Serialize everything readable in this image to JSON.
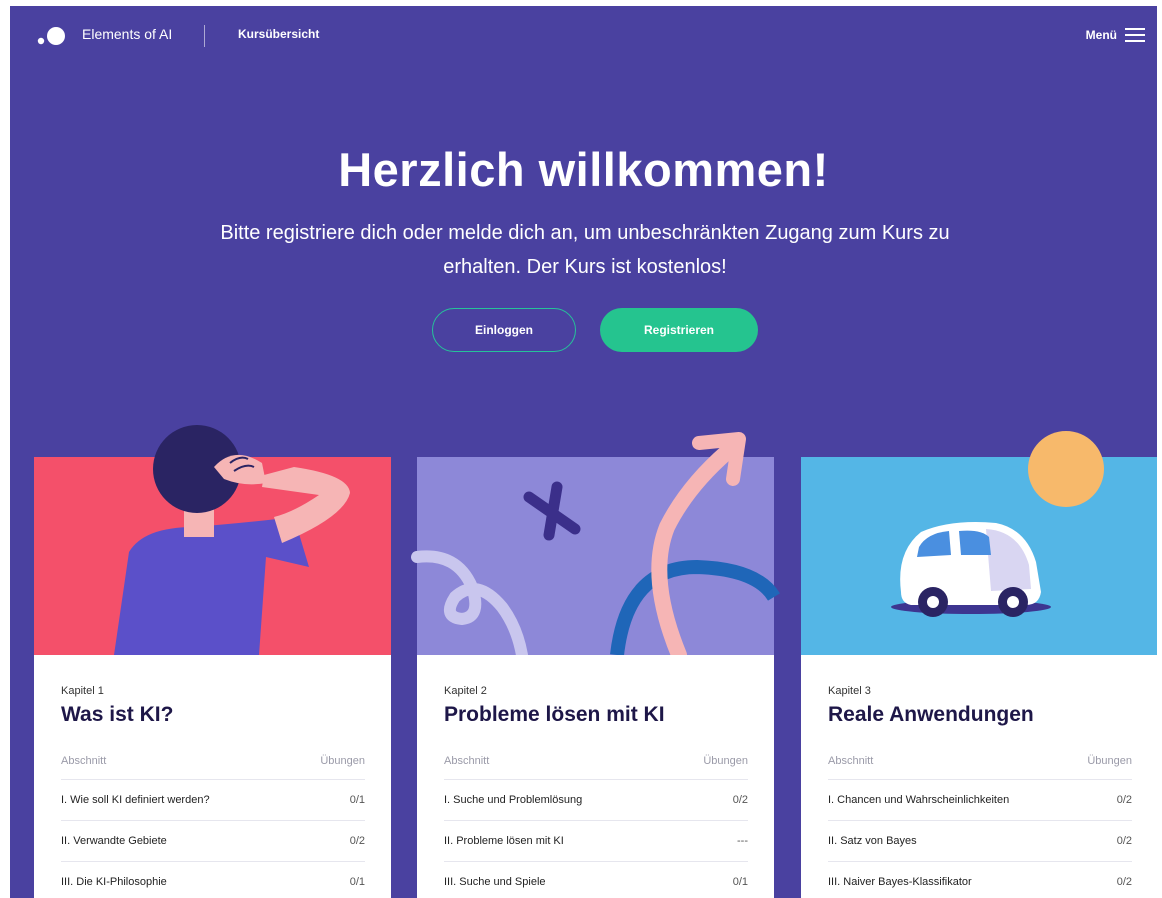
{
  "header": {
    "brand": "Elements of AI",
    "nav_title": "Kursübersicht",
    "menu_label": "Menü"
  },
  "hero": {
    "title": "Herzlich willkommen!",
    "subtitle_line1": "Bitte registriere dich oder melde dich an, um unbeschränkten Zugang zum Kurs zu",
    "subtitle_line2": "erhalten. Der Kurs ist kostenlos!",
    "login_label": "Einloggen",
    "register_label": "Registrieren"
  },
  "colors": {
    "background": "#4a41a0",
    "accent_green": "#25c48f",
    "card1_art": "#f4506a",
    "card2_art": "#8d88d8",
    "card3_art": "#54b6e6"
  },
  "cards": [
    {
      "kapitel": "Kapitel 1",
      "title": "Was ist KI?",
      "col_section": "Abschnitt",
      "col_exercises": "Übungen",
      "rows": [
        {
          "section": "I. Wie soll KI definiert werden?",
          "count": "0/1"
        },
        {
          "section": "II. Verwandte Gebiete",
          "count": "0/2"
        },
        {
          "section": "III. Die KI-Philosophie",
          "count": "0/1"
        }
      ]
    },
    {
      "kapitel": "Kapitel 2",
      "title": "Probleme lösen mit KI",
      "col_section": "Abschnitt",
      "col_exercises": "Übungen",
      "rows": [
        {
          "section": "I. Suche und Problemlösung",
          "count": "0/2"
        },
        {
          "section": "II. Probleme lösen mit KI",
          "count": "---"
        },
        {
          "section": "III. Suche und Spiele",
          "count": "0/1"
        }
      ]
    },
    {
      "kapitel": "Kapitel 3",
      "title": "Reale Anwendungen",
      "col_section": "Abschnitt",
      "col_exercises": "Übungen",
      "rows": [
        {
          "section": "I. Chancen und Wahrscheinlichkeiten",
          "count": "0/2"
        },
        {
          "section": "II. Satz von Bayes",
          "count": "0/2"
        },
        {
          "section": "III. Naiver Bayes-Klassifikator",
          "count": "0/2"
        }
      ]
    }
  ]
}
